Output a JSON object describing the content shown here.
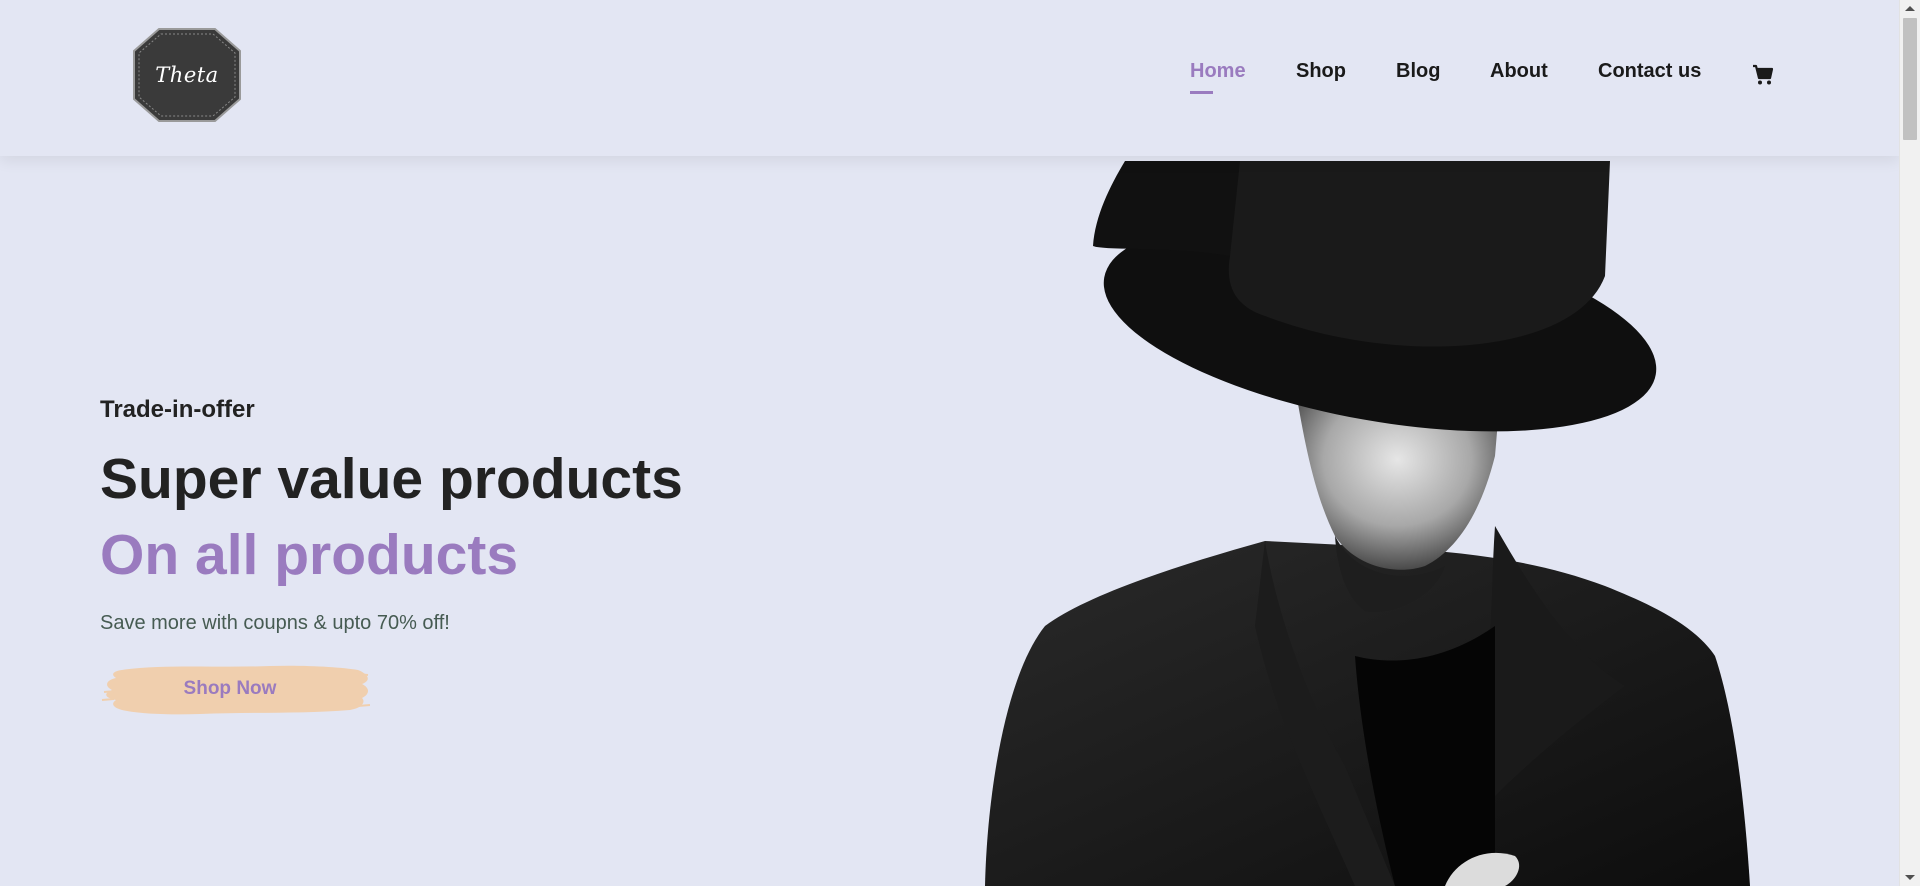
{
  "header": {
    "logo_text": "Theta",
    "nav": [
      {
        "label": "Home",
        "active": true
      },
      {
        "label": "Shop",
        "active": false
      },
      {
        "label": "Blog",
        "active": false
      },
      {
        "label": "About",
        "active": false
      },
      {
        "label": "Contact us",
        "active": false
      }
    ],
    "cart_icon": "shopping-cart-icon"
  },
  "hero": {
    "tagline": "Trade-in-offer",
    "headline": "Super value products",
    "highlight": "On all products",
    "subtext": "Save more with coupns & upto 70% off!",
    "cta_label": "Shop Now",
    "image": "man-in-black-hat-and-coat"
  },
  "colors": {
    "background": "#e3e6f3",
    "accent": "#9a7bbf",
    "button_bg": "#f0cfae",
    "text_dark": "#222222"
  }
}
